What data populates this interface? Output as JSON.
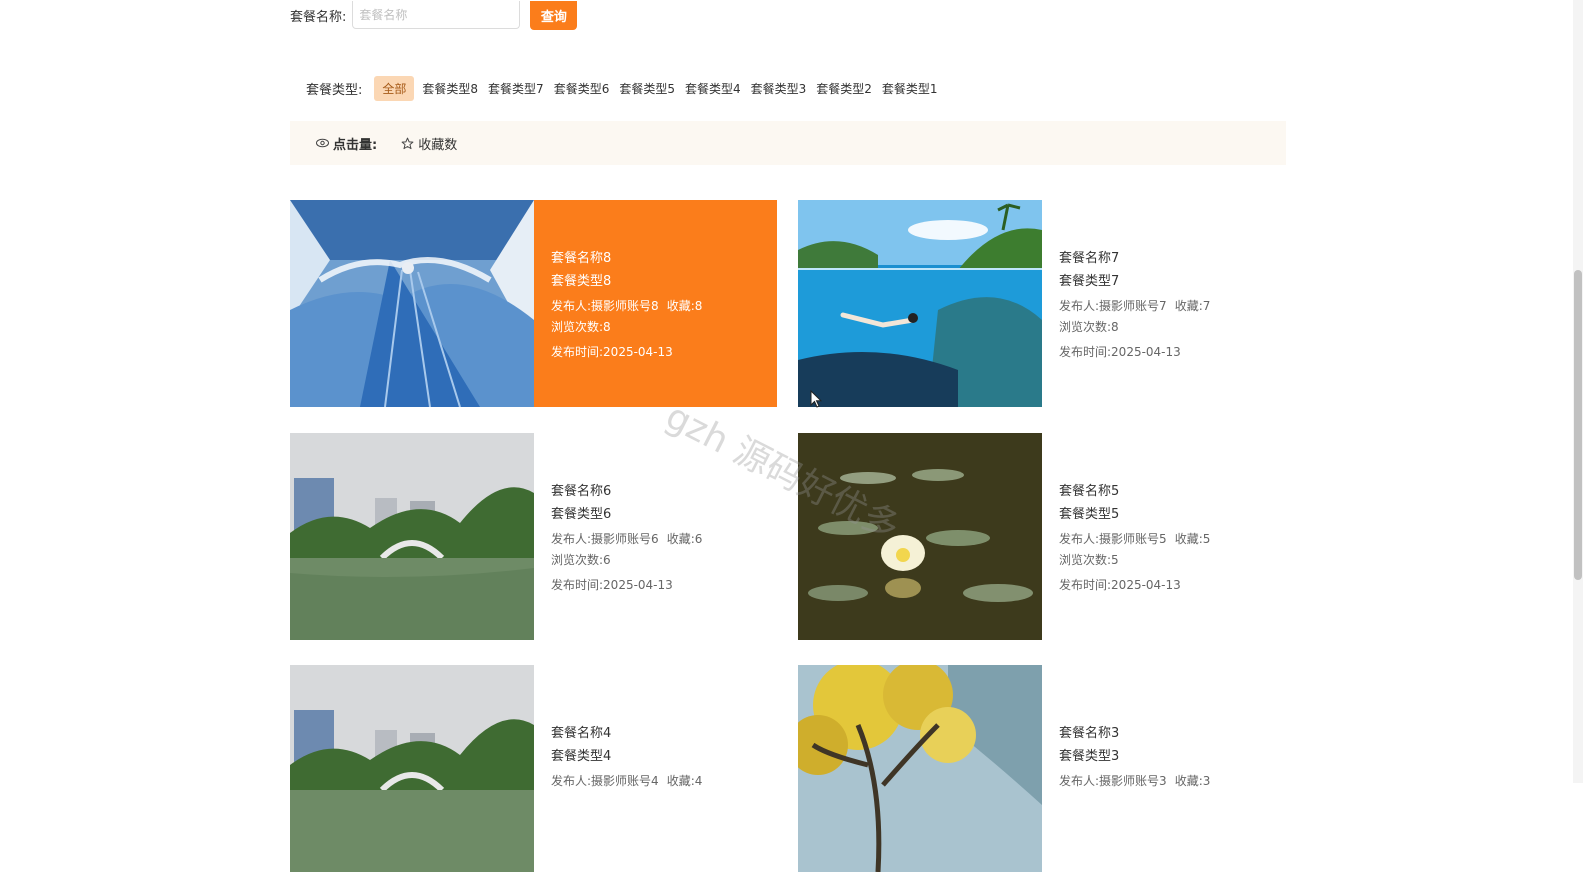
{
  "search": {
    "label": "套餐名称:",
    "placeholder": "套餐名称",
    "button": "查询"
  },
  "types": {
    "label": "套餐类型:",
    "items": [
      "全部",
      "套餐类型8",
      "套餐类型7",
      "套餐类型6",
      "套餐类型5",
      "套餐类型4",
      "套餐类型3",
      "套餐类型2",
      "套餐类型1"
    ],
    "active": "全部"
  },
  "sort": {
    "clicks_label": "点击量:",
    "favs_label": "收藏数",
    "clicks_icon": "eye-icon",
    "favs_icon": "star-icon"
  },
  "cards": [
    {
      "name": "套餐名称8",
      "type": "套餐类型8",
      "publisher": "发布人:摄影师账号8",
      "favorites": "收藏:8",
      "views": "浏览次数:8",
      "date": "发布时间:2025-04-13",
      "image": "blue-ice-dress-photo",
      "highlighted": true
    },
    {
      "name": "套餐名称7",
      "type": "套餐类型7",
      "publisher": "发布人:摄影师账号7",
      "favorites": "收藏:7",
      "views": "浏览次数:8",
      "date": "发布时间:2025-04-13",
      "image": "underwater-diver-photo",
      "highlighted": false
    },
    {
      "name": "套餐名称6",
      "type": "套餐类型6",
      "publisher": "发布人:摄影师账号6",
      "favorites": "收藏:6",
      "views": "浏览次数:6",
      "date": "发布时间:2025-04-13",
      "image": "park-lake-bridge-photo",
      "highlighted": false
    },
    {
      "name": "套餐名称5",
      "type": "套餐类型5",
      "publisher": "发布人:摄影师账号5",
      "favorites": "收藏:5",
      "views": "浏览次数:5",
      "date": "发布时间:2025-04-13",
      "image": "water-lily-photo",
      "highlighted": false
    },
    {
      "name": "套餐名称4",
      "type": "套餐类型4",
      "publisher": "发布人:摄影师账号4",
      "favorites": "收藏:4",
      "views": "",
      "date": "",
      "image": "park-lake-bridge-photo",
      "highlighted": false
    },
    {
      "name": "套餐名称3",
      "type": "套餐类型3",
      "publisher": "发布人:摄影师账号3",
      "favorites": "收藏:3",
      "views": "",
      "date": "",
      "image": "yellow-tree-photo",
      "highlighted": false
    }
  ],
  "watermark": "gzh 源码好优多",
  "colors": {
    "accent": "#fb7d1b",
    "active_tag_bg": "#fbd7b4",
    "sort_bar_bg": "#fcf8f2"
  }
}
